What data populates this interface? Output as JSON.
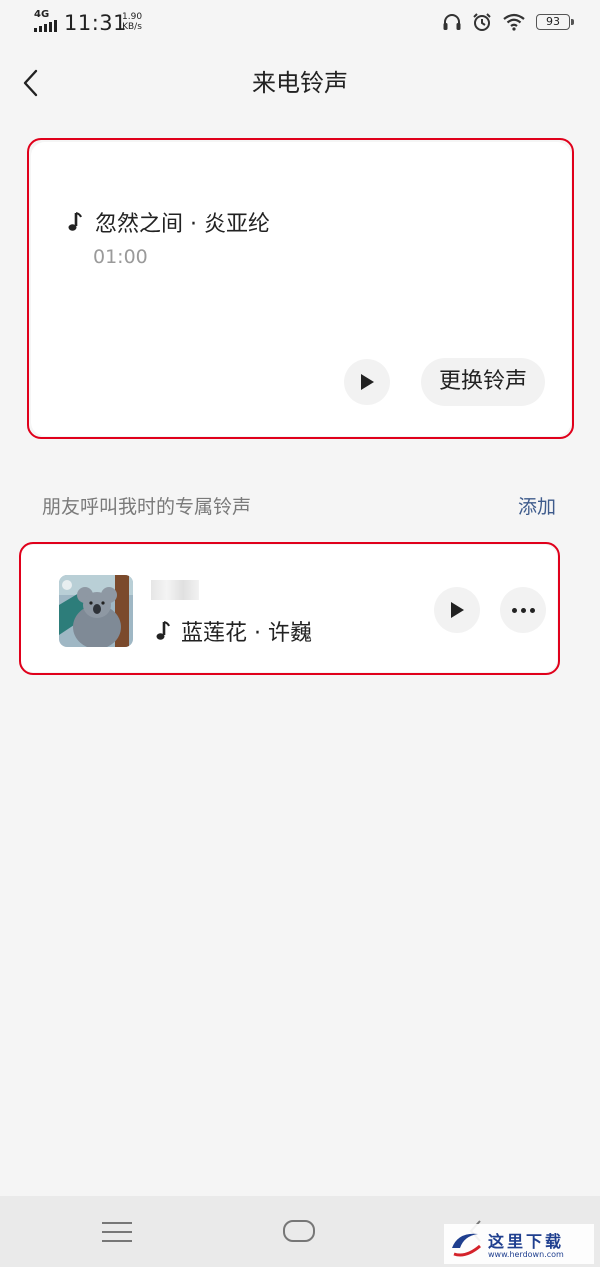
{
  "status_bar": {
    "network": "4G",
    "time": "11:31",
    "speed_value": "1.90",
    "speed_unit": "KB/s",
    "battery": "93",
    "icons": [
      "headset-icon",
      "alarm-icon",
      "wifi-icon"
    ]
  },
  "header": {
    "title": "来电铃声",
    "back_icon": "back-chevron-icon"
  },
  "current_ringtone": {
    "song": "忽然之间 · 炎亚纶",
    "duration": "01:00",
    "change_label": "更换铃声"
  },
  "friends_section": {
    "label": "朋友呼叫我时的专属铃声",
    "add_label": "添加",
    "items": [
      {
        "song": "蓝莲花 · 许巍"
      }
    ]
  },
  "nav": {
    "icons": [
      "menu-icon",
      "home-icon",
      "back-icon"
    ]
  },
  "watermark": {
    "text": "这里下载",
    "url": "www.herdown.com"
  },
  "colors": {
    "highlight": "#e0001b",
    "link": "#3e5b8c",
    "background": "#f5f5f5"
  }
}
